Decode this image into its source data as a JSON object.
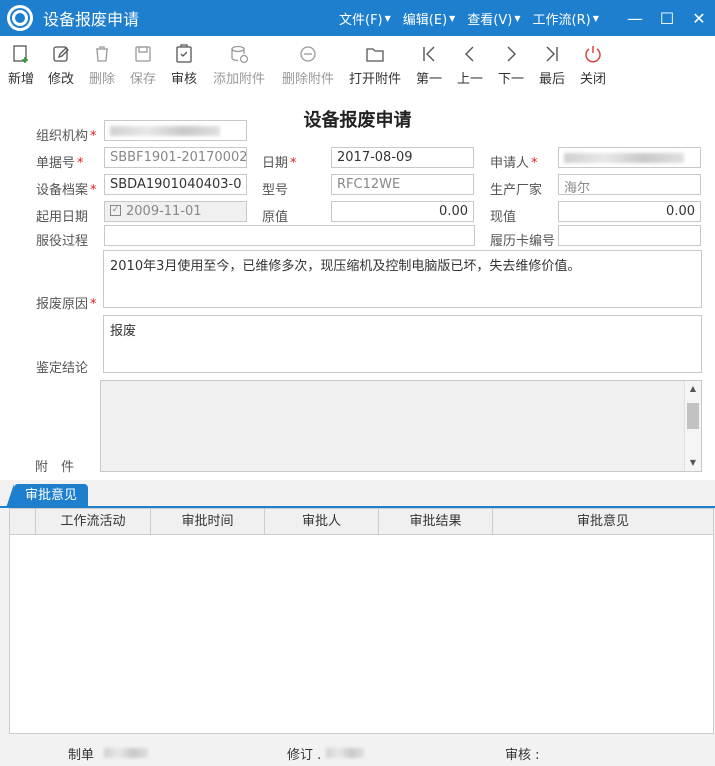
{
  "window": {
    "title": "设备报废申请"
  },
  "menus": [
    {
      "label": "文件(F)"
    },
    {
      "label": "编辑(E)"
    },
    {
      "label": "查看(V)"
    },
    {
      "label": "工作流(R)"
    }
  ],
  "window_controls": {
    "minimize": "—",
    "maximize": "☐",
    "close": "✕"
  },
  "toolbar": [
    {
      "label": "新增",
      "icon": "new-doc-icon",
      "enabled": true
    },
    {
      "label": "修改",
      "icon": "edit-icon",
      "enabled": true
    },
    {
      "label": "删除",
      "icon": "trash-icon",
      "enabled": false
    },
    {
      "label": "保存",
      "icon": "save-icon",
      "enabled": false
    },
    {
      "label": "审核",
      "icon": "clipboard-check-icon",
      "enabled": true
    },
    {
      "label": "添加附件",
      "icon": "add-attachment-icon",
      "enabled": false
    },
    {
      "label": "删除附件",
      "icon": "remove-attachment-icon",
      "enabled": false
    },
    {
      "label": "打开附件",
      "icon": "folder-icon",
      "enabled": true
    },
    {
      "label": "第一",
      "icon": "first-icon",
      "enabled": true
    },
    {
      "label": "上一",
      "icon": "prev-icon",
      "enabled": true
    },
    {
      "label": "下一",
      "icon": "next-icon",
      "enabled": true
    },
    {
      "label": "最后",
      "icon": "last-icon",
      "enabled": true
    },
    {
      "label": "关闭",
      "icon": "power-icon",
      "enabled": true
    }
  ],
  "form": {
    "title": "设备报废申请",
    "org_label": "组织机构",
    "doc_no_label": "单据号",
    "doc_no": "SBBF1901-20170002",
    "date_label": "日期",
    "date": "2017-08-09",
    "applicant_label": "申请人",
    "archive_label": "设备档案",
    "archive": "SBDA1901040403-0",
    "model_label": "型号",
    "model": "RFC12WE",
    "maker_label": "生产厂家",
    "maker": "海尔",
    "start_date_label": "起用日期",
    "start_date": "2009-11-01",
    "orig_value_label": "原值",
    "orig_value": "0.00",
    "cur_value_label": "现值",
    "cur_value": "0.00",
    "service_label": "服役过程",
    "record_card_label": "履历卡编号",
    "reason_label": "报废原因",
    "reason": "2010年3月使用至今，已维修多次，现压缩机及控制电脑版已坏，失去维修价值。",
    "conclusion_label": "鉴定结论",
    "conclusion": "报废",
    "attachment_label": "附　件"
  },
  "tab": {
    "label": "审批意见"
  },
  "table": {
    "columns": [
      "工作流活动",
      "审批时间",
      "审批人",
      "审批结果",
      "审批意见"
    ],
    "rows": []
  },
  "footer": {
    "maker_label": "制单",
    "revise_label": "修订 .",
    "audit_label": "审核 :"
  },
  "colors": {
    "accent": "#1e7fcf",
    "required": "#e02020"
  }
}
